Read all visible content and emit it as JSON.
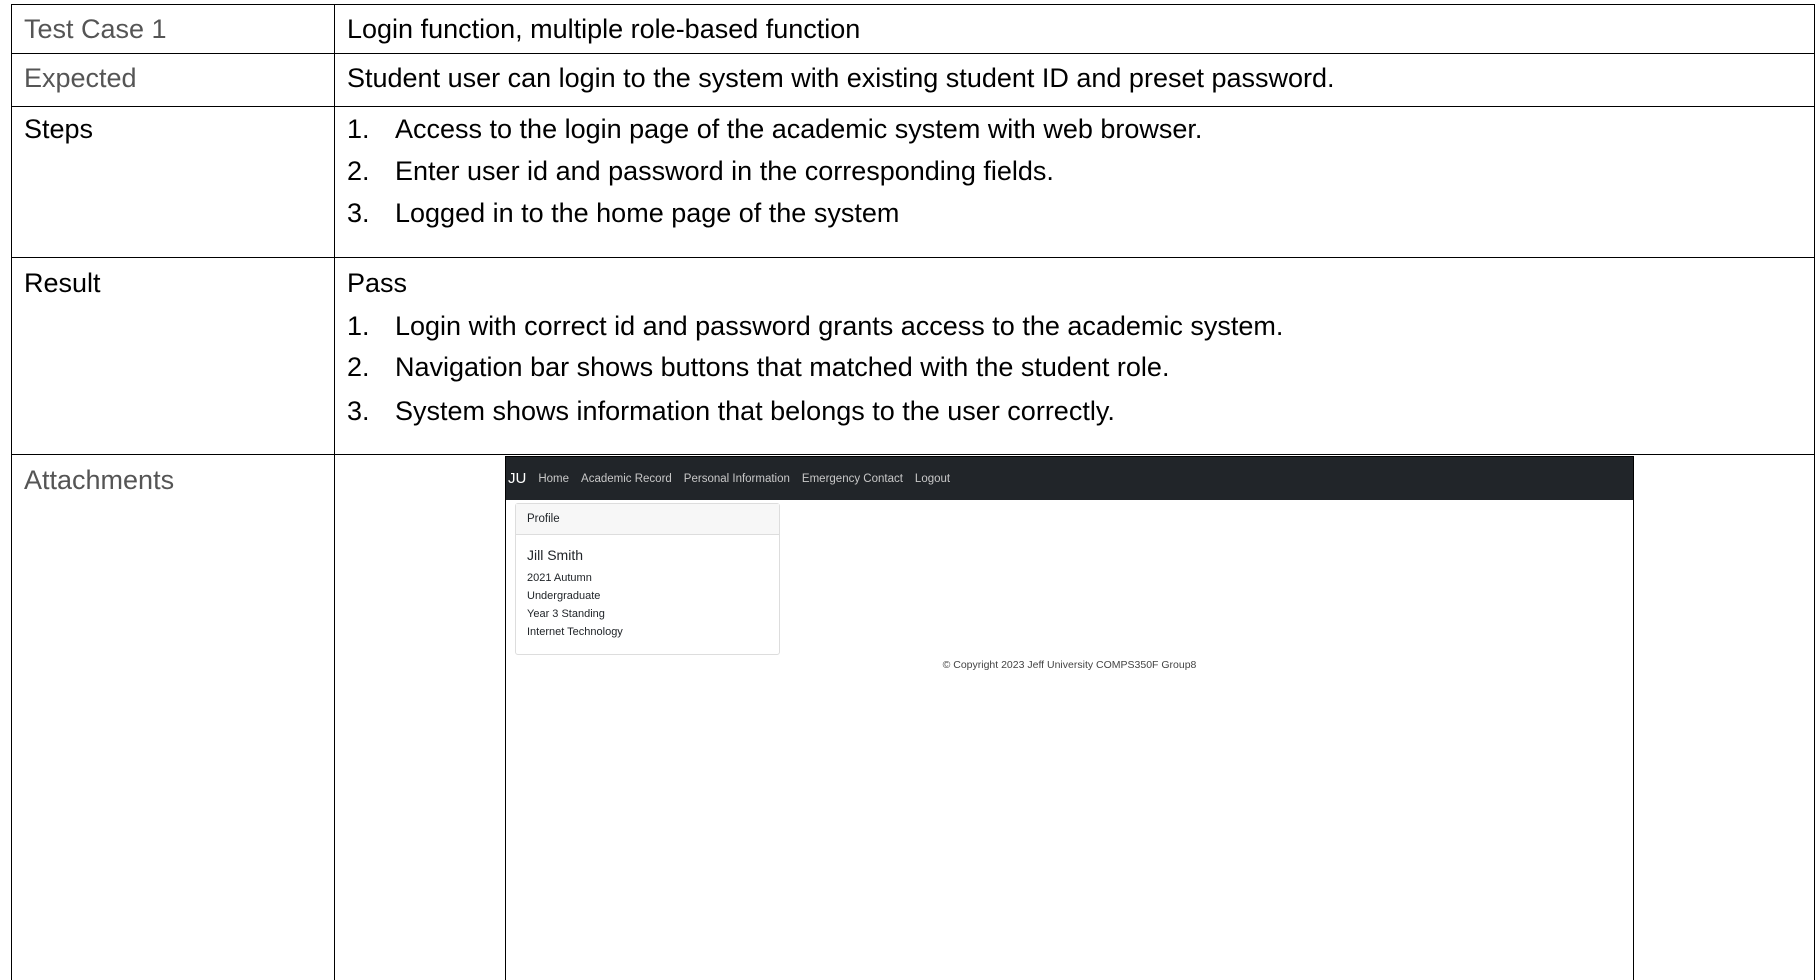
{
  "table": {
    "test_case_label": "Test Case 1",
    "test_case_value": "Login function, multiple role-based function",
    "expected_label": "Expected",
    "expected_value": "Student user can login to the system with existing student ID and preset password.",
    "steps_label": "Steps",
    "steps": [
      {
        "num": "1.",
        "text": "Access to the login page of the academic system with web browser."
      },
      {
        "num": "2.",
        "text": "Enter user id and password in the corresponding fields."
      },
      {
        "num": "3.",
        "text": "Logged in to the home page of the system"
      }
    ],
    "result_label": "Result",
    "result_status": "Pass",
    "results": [
      {
        "num": "1.",
        "text": "Login with correct id and password grants access to the academic system."
      },
      {
        "num": "2.",
        "text": "Navigation bar shows buttons that matched with the student role."
      },
      {
        "num": "3.",
        "text": "System shows information that belongs to the user correctly."
      }
    ],
    "attachments_label": "Attachments"
  },
  "screenshot": {
    "brand": "JU",
    "nav_links": [
      "Home",
      "Academic Record",
      "Personal Information",
      "Emergency Contact",
      "Logout"
    ],
    "nav_bg_color": "#212529",
    "profile": {
      "header": "Profile",
      "name": "Jill Smith",
      "lines": [
        "2021 Autumn",
        "Undergraduate",
        "Year 3 Standing",
        "Internet Technology"
      ]
    },
    "footer": "© Copyright 2023 Jeff University COMPS350F Group8"
  }
}
